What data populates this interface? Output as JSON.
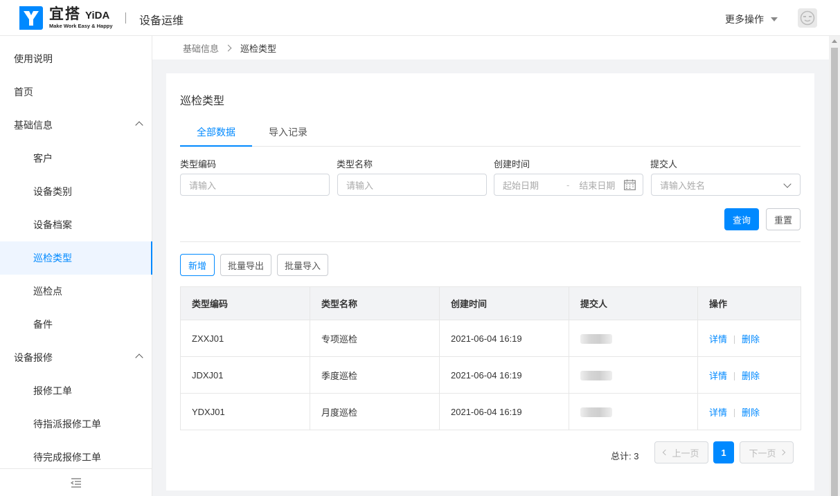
{
  "header": {
    "logo_cn": "宜搭",
    "logo_en": "YiDA",
    "logo_slogan": "Make Work Easy & Happy",
    "app_title": "设备运维",
    "more_ops": "更多操作",
    "brand_color": "#0089ff"
  },
  "sidebar": {
    "items": [
      {
        "label": "使用说明"
      },
      {
        "label": "首页"
      },
      {
        "label": "基础信息"
      },
      {
        "label": "客户"
      },
      {
        "label": "设备类别"
      },
      {
        "label": "设备档案"
      },
      {
        "label": "巡检类型"
      },
      {
        "label": "巡检点"
      },
      {
        "label": "备件"
      },
      {
        "label": "设备报修"
      },
      {
        "label": "报修工单"
      },
      {
        "label": "待指派报修工单"
      },
      {
        "label": "待完成报修工单"
      }
    ],
    "active": "巡检类型",
    "collapse_icon": "collapse-menu-icon"
  },
  "breadcrumb": {
    "parent": "基础信息",
    "current": "巡检类型"
  },
  "main": {
    "title": "巡检类型",
    "tabs": [
      {
        "label": "全部数据"
      },
      {
        "label": "导入记录"
      }
    ],
    "filters": {
      "type_code": {
        "label": "类型编码",
        "placeholder": "请输入"
      },
      "type_name": {
        "label": "类型名称",
        "placeholder": "请输入"
      },
      "created_at": {
        "label": "创建时间",
        "start_placeholder": "起始日期",
        "end_placeholder": "结束日期",
        "separator": "-"
      },
      "submitter": {
        "label": "提交人",
        "placeholder": "请输入姓名"
      }
    },
    "buttons": {
      "query": "查询",
      "reset": "重置",
      "add": "新增",
      "batch_export": "批量导出",
      "batch_import": "批量导入"
    },
    "table": {
      "columns": [
        "类型编码",
        "类型名称",
        "创建时间",
        "提交人",
        "操作"
      ],
      "rows": [
        {
          "code": "ZXXJ01",
          "name": "专项巡检",
          "created": "2021-06-04 16:19"
        },
        {
          "code": "JDXJ01",
          "name": "季度巡检",
          "created": "2021-06-04 16:19"
        },
        {
          "code": "YDXJ01",
          "name": "月度巡检",
          "created": "2021-06-04 16:19"
        }
      ],
      "actions": {
        "detail": "详情",
        "delete": "删除"
      }
    },
    "pagination": {
      "total": "总计: 3",
      "prev": "上一页",
      "next": "下一页",
      "current_page": "1"
    }
  }
}
